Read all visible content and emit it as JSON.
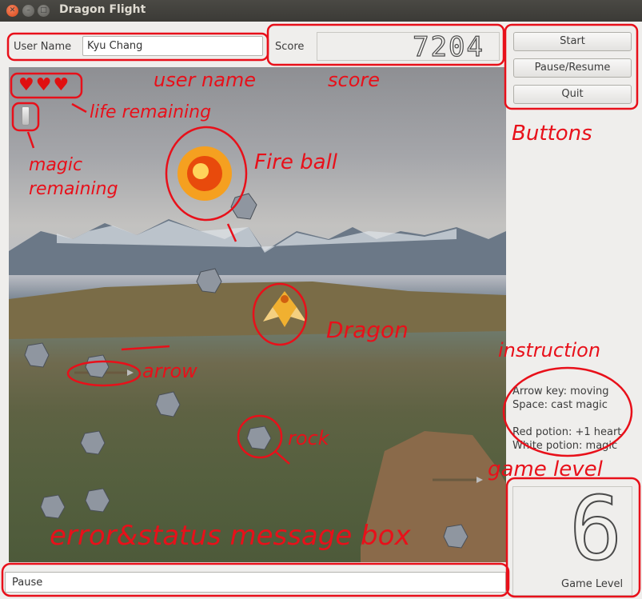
{
  "window": {
    "title": "Dragon Flight"
  },
  "top": {
    "username_label": "User Name",
    "username_value": "Kyu Chang",
    "score_label": "Score",
    "score_value": "7204"
  },
  "buttons": {
    "start": "Start",
    "pause_resume": "Pause/Resume",
    "quit": "Quit"
  },
  "hud": {
    "hearts": "♥♥♥",
    "hearts_count": 3,
    "magic_count": 1
  },
  "instructions": {
    "line1": "Arrow key: moving",
    "line2": "Space: cast magic",
    "line3": "Red potion: +1 heart",
    "line4": "White potion: magic"
  },
  "level": {
    "value": "6",
    "label": "Game Level"
  },
  "status": {
    "message": "Pause"
  },
  "annotations": {
    "user_name": "user name",
    "score": "score",
    "buttons": "Buttons",
    "life": "life remaining",
    "magic": "magic remaining",
    "fireball": "Fire ball",
    "dragon": "Dragon",
    "arrow": "arrow",
    "rock": "rock",
    "instruction": "instruction",
    "game_level": "game level",
    "status_box": "error&status message box"
  }
}
